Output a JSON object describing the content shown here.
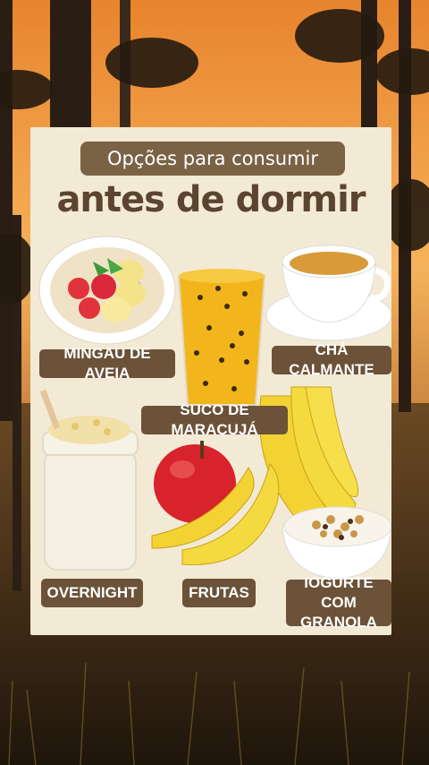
{
  "card": {
    "title_pill": "Opções para consumir",
    "headline": "antes de dormir"
  },
  "items": {
    "mingau": "MINGAU DE AVEIA",
    "cha": "CHÁ CALMANTE",
    "suco": "SUCO DE MARACUJÁ",
    "overnight": "OVERNIGHT",
    "frutas": "FRUTAS",
    "iogurte_line1": "IOGURTE COM",
    "iogurte_line2": "GRANOLA"
  },
  "colors": {
    "label_bg": "#6b5238",
    "title_pill_bg": "#7a6244",
    "headline": "#5b4430",
    "card_bg": "#f3ead6",
    "sunset": "#f0a04a"
  }
}
